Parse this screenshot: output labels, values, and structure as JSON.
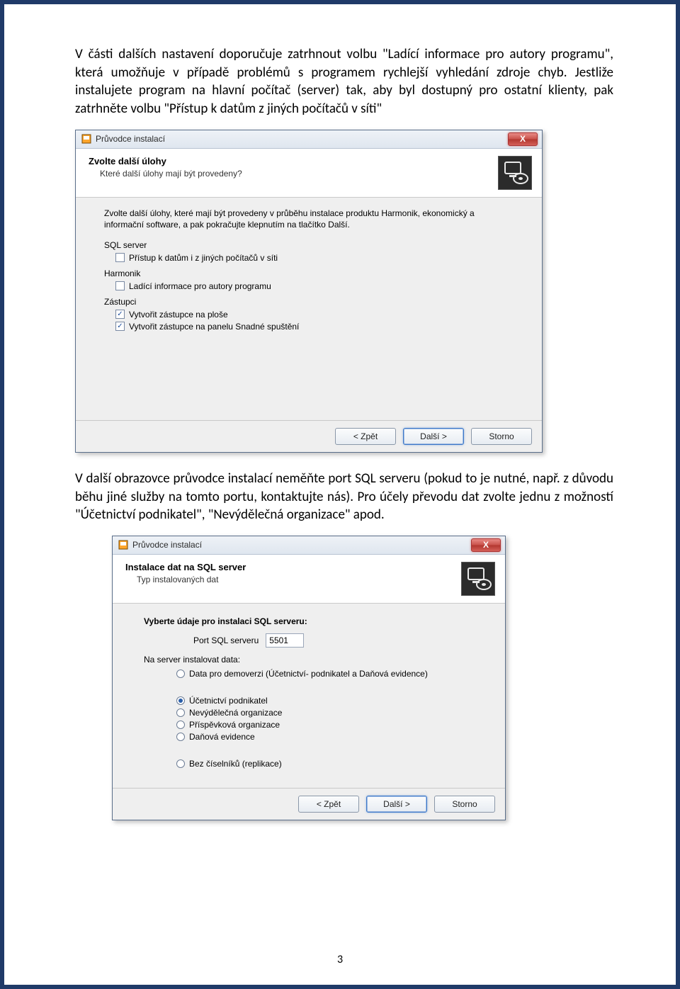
{
  "para1": "V části dalších nastavení doporučuje zatrhnout volbu \"Ladící informace pro autory programu\", která umožňuje v případě problémů s programem rychlejší vyhledání zdroje chyb. Jestliže instalujete program na hlavní počítač (server) tak, aby byl dostupný pro ostatní klienty, pak zatrhněte volbu \"Přístup k datům z jiných počítačů v síti\"",
  "para2": "V další obrazovce průvodce instalací neměňte port SQL serveru (pokud to je nutné, např. z důvodu běhu jiné služby na tomto portu, kontaktujte nás). Pro účely převodu dat zvolte jednu z možností \"Účetnictví podnikatel\", \"Nevýdělečná organizace\" apod.",
  "wizard_title": "Průvodce instalací",
  "close_x": "X",
  "dlg1": {
    "heading": "Zvolte další úlohy",
    "sub": "Které další úlohy mají být provedeny?",
    "intro": "Zvolte další úlohy, které mají být provedeny v průběhu instalace produktu Harmonik, ekonomický a informační software, a pak pokračujte klepnutím na tlačítko Další.",
    "g1": "SQL server",
    "c1": "Přístup k datům i z jiných počítačů v síti",
    "g2": "Harmonik",
    "c2": "Ladící informace pro autory programu",
    "g3": "Zástupci",
    "c3": "Vytvořit zástupce na ploše",
    "c4": "Vytvořit zástupce na panelu Snadné spuštění"
  },
  "dlg2": {
    "heading": "Instalace dat na SQL server",
    "sub": "Typ instalovaných dat",
    "subhead": "Vyberte údaje pro instalaci SQL serveru:",
    "port_label": "Port SQL serveru",
    "port_value": "5501",
    "data_label": "Na server instalovat data:",
    "r1": "Data pro demoverzi (Účetnictví- podnikatel a Daňová evidence)",
    "r2": "Účetnictví podnikatel",
    "r3": "Nevýdělečná organizace",
    "r4": "Příspěvková organizace",
    "r5": "Daňová evidence",
    "r6": "Bez číselníků (replikace)"
  },
  "btn_back": "< Zpět",
  "btn_next": "Další >",
  "btn_cancel": "Storno",
  "page_num": "3"
}
